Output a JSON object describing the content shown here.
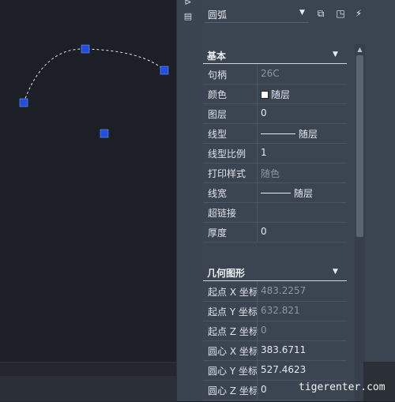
{
  "selector": {
    "value": "圆弧"
  },
  "toolbar": {
    "icons": [
      "quick-select-icon",
      "select-objects-icon",
      "toggle-pickadd-icon"
    ]
  },
  "side_icons": [
    "pin-icon",
    "panel-menu-icon"
  ],
  "sections": [
    {
      "title": "基本",
      "rows": [
        {
          "key": "句柄",
          "value": "26C",
          "dim": true
        },
        {
          "key": "颜色",
          "value": "随层",
          "swatch": true
        },
        {
          "key": "图层",
          "value": "0"
        },
        {
          "key": "线型",
          "value": "随层",
          "line": true
        },
        {
          "key": "线型比例",
          "value": "1"
        },
        {
          "key": "打印样式",
          "value": "随色",
          "dim": true
        },
        {
          "key": "线宽",
          "value": "随层",
          "line": true
        },
        {
          "key": "超链接",
          "value": ""
        },
        {
          "key": "厚度",
          "value": "0"
        }
      ]
    },
    {
      "title": "几何图形",
      "rows": [
        {
          "key": "起点 X 坐标",
          "value": "483.2257",
          "dim": true
        },
        {
          "key": "起点 Y 坐标",
          "value": "632.821",
          "dim": true
        },
        {
          "key": "起点 Z 坐标",
          "value": "0",
          "dim": true
        },
        {
          "key": "圆心 X 坐标",
          "value": "383.6711"
        },
        {
          "key": "圆心 Y 坐标",
          "value": "527.4623"
        },
        {
          "key": "圆心 Z 坐标",
          "value": "0"
        }
      ]
    }
  ],
  "watermark": "tigerenter.com",
  "colors": {
    "grip": "#1f4fe0",
    "panel": "#3b4552",
    "canvas": "#1c1f25"
  }
}
